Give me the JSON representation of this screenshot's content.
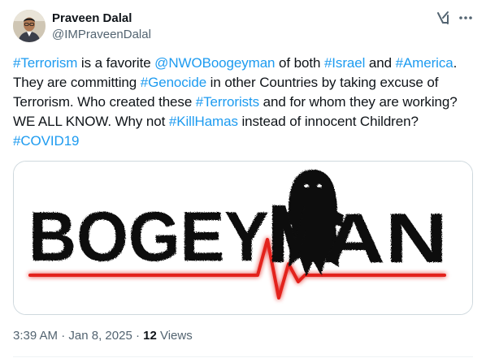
{
  "author": {
    "display_name": "Praveen Dalal",
    "handle": "@IMPraveenDalal"
  },
  "icons": {
    "grok": "grok-icon",
    "more": "more-icon"
  },
  "tweet": {
    "segments": [
      {
        "text": "#Terrorism",
        "type": "hashtag"
      },
      {
        "text": " is a favorite ",
        "type": "text"
      },
      {
        "text": "@NWOBoogeyman",
        "type": "mention"
      },
      {
        "text": " of both ",
        "type": "text"
      },
      {
        "text": "#Israel",
        "type": "hashtag"
      },
      {
        "text": " and ",
        "type": "text"
      },
      {
        "text": "#America",
        "type": "hashtag"
      },
      {
        "text": ". They are committing ",
        "type": "text"
      },
      {
        "text": "#Genocide",
        "type": "hashtag"
      },
      {
        "text": " in other Countries by taking excuse of Terrorism. Who created these ",
        "type": "text"
      },
      {
        "text": "#Terrorists",
        "type": "hashtag"
      },
      {
        "text": " and for whom they are working? WE ALL KNOW. Why not ",
        "type": "text"
      },
      {
        "text": "#KillHamas",
        "type": "hashtag"
      },
      {
        "text": " instead of innocent Children? ",
        "type": "text"
      },
      {
        "text": "#COVID19",
        "type": "hashtag"
      }
    ]
  },
  "media": {
    "word_left": "BOGEY",
    "word_right": "AN",
    "brand_color": "#111111",
    "pulse_color": "#e3201b",
    "eye_color": "#ffffff"
  },
  "meta": {
    "time": "3:39 AM",
    "separator_1": " · ",
    "date": "Jan 8, 2025",
    "separator_2": " · ",
    "views_count": "12",
    "views_label": " Views"
  },
  "colors": {
    "link": "#1d9bf0",
    "text": "#0f1419",
    "secondary": "#536471",
    "border": "#cfd9de"
  }
}
